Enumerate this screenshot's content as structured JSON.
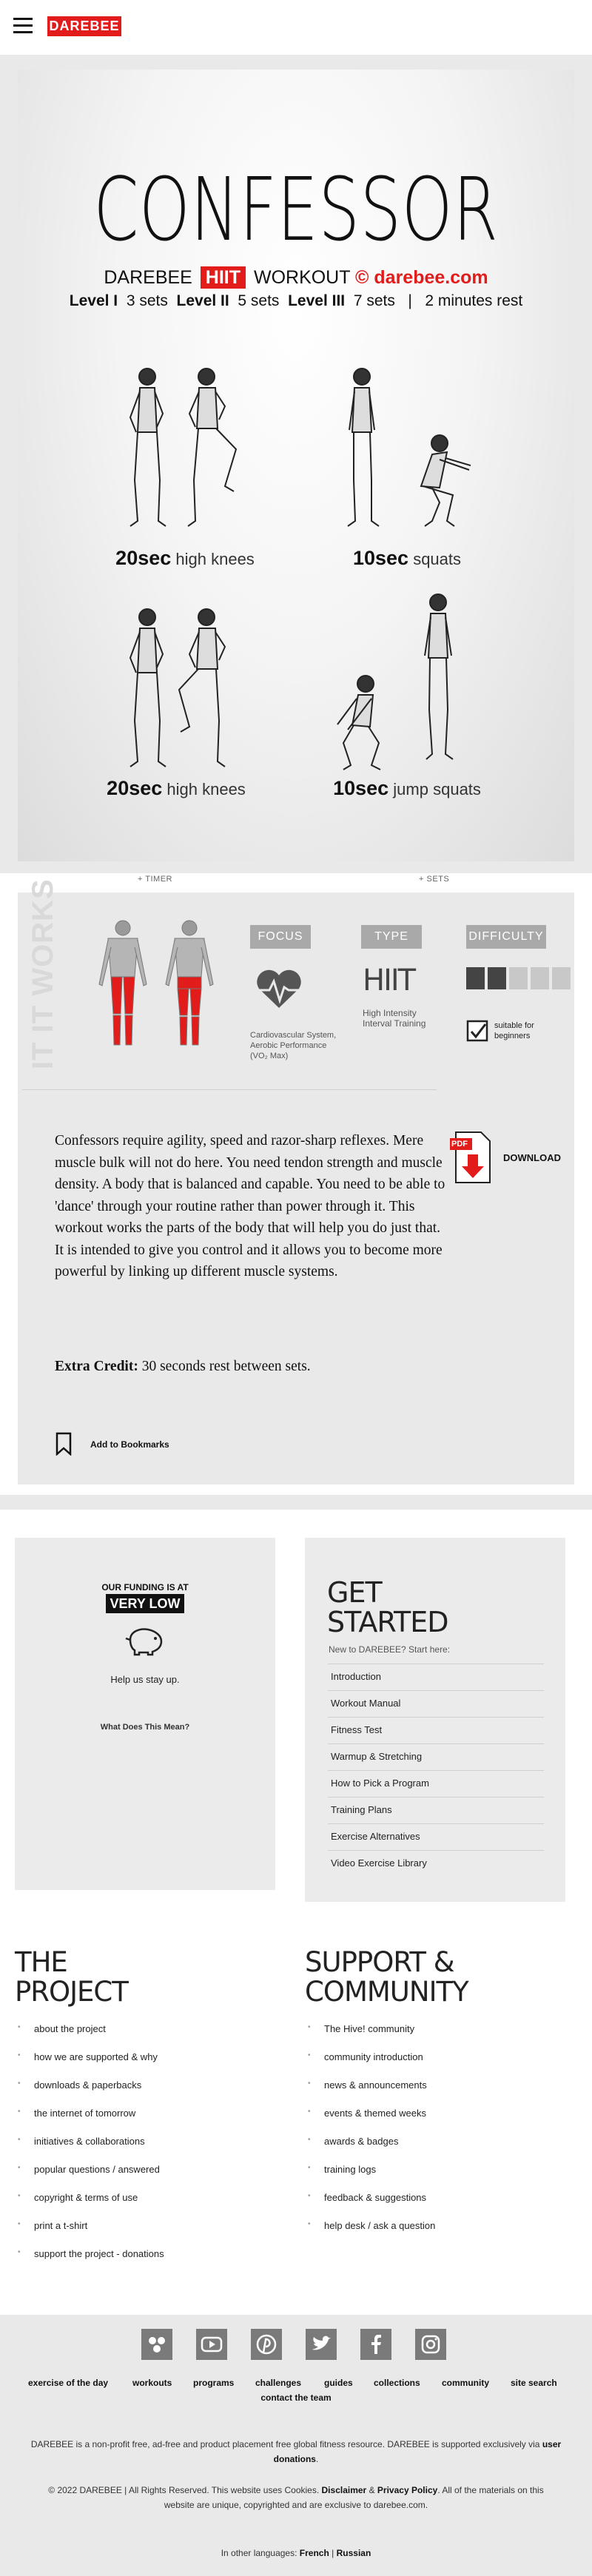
{
  "header": {
    "logo": "DAREBEE",
    "menu_icon": "hamburger-icon"
  },
  "poster": {
    "title": "CONFESSOR",
    "brand_prefix": "DAREBEE",
    "brand_badge": "HIIT",
    "brand_word": "WORKOUT",
    "brand_copyright": "©",
    "brand_site": "darebee.com",
    "levels": [
      {
        "label": "Level I",
        "value": "3 sets"
      },
      {
        "label": "Level II",
        "value": "5 sets"
      },
      {
        "label": "Level III",
        "value": "7 sets"
      }
    ],
    "separator": "|",
    "rest": "2 minutes rest",
    "exercises": [
      {
        "time": "20sec",
        "name": "high knees"
      },
      {
        "time": "10sec",
        "name": "squats"
      },
      {
        "time": "20sec",
        "name": "high knees"
      },
      {
        "time": "10sec",
        "name": "jump squats"
      }
    ]
  },
  "toggles": {
    "timer": "+ TIMER",
    "sets": "+ SETS"
  },
  "info": {
    "side_label": "IT IT WORKS",
    "focus": {
      "heading": "FOCUS",
      "text": "Cardiovascular System, Aerobic Performance (VO₂ Max)",
      "icon": "heart-rate-icon"
    },
    "type": {
      "heading": "TYPE",
      "value": "HIIT",
      "text": "High Intensity Interval Training"
    },
    "difficulty": {
      "heading": "DIFFICULTY",
      "level": 0.4,
      "check_text": "suitable for beginners"
    },
    "colors": {
      "accent": "#e21b1b",
      "badge": "#a9a9a9",
      "bar_on": "#444444",
      "bar_off": "#c8c8c8"
    },
    "description": "Confessors require agility, speed and razor-sharp reflexes. Mere muscle bulk will not do here. You need tendon strength and muscle density. A body that is balanced and capable. You need to be able to 'dance' through your routine rather than power through it. This workout works the parts of the body that will help you do just that. It is intended to give you control and it allows you to become more powerful by linking up different muscle systems.",
    "extra_credit_label": "Extra Credit:",
    "extra_credit_text": "30 seconds rest between sets.",
    "download_label": "DOWNLOAD",
    "pdf_badge": "PDF",
    "bookmark_label": "Add to Bookmarks"
  },
  "funding": {
    "line1": "OUR FUNDING IS AT",
    "line2": "VERY LOW",
    "help": "Help us stay up.",
    "link": "What Does This Mean?"
  },
  "get_started": {
    "title_line1": "GET",
    "title_line2": "STARTED",
    "subtitle": "New to DAREBEE? Start here:",
    "items": [
      "Introduction",
      "Workout Manual",
      "Fitness Test",
      "Warmup & Stretching",
      "How to Pick a Program",
      "Training Plans",
      "Exercise Alternatives",
      "Video Exercise Library"
    ]
  },
  "project": {
    "title_line1": "THE",
    "title_line2": "PROJECT",
    "items": [
      "about the project",
      "how we are supported & why",
      "downloads & paperbacks",
      "the internet of tomorrow",
      "initiatives & collaborations",
      "popular questions / answered",
      "copyright & terms of use",
      "print a t-shirt",
      "support the project - donations"
    ]
  },
  "support": {
    "title_line1": "SUPPORT &",
    "title_line2": "COMMUNITY",
    "items": [
      "The Hive! community",
      "community introduction",
      "news & announcements",
      "events & themed weeks",
      "awards & badges",
      "training logs",
      "feedback & suggestions",
      "help desk / ask a question"
    ]
  },
  "footer": {
    "social": [
      "hive-icon",
      "youtube-icon",
      "pinterest-icon",
      "twitter-icon",
      "facebook-icon",
      "instagram-icon"
    ],
    "links": [
      "exercise of the day",
      "workouts",
      "programs",
      "challenges",
      "guides",
      "collections",
      "community",
      "site search"
    ],
    "contact": "contact the team",
    "about": "DAREBEE is a non-profit free, ad-free and product placement free global fitness resource. DAREBEE is supported exclusively via",
    "about_link": "user donations",
    "about_end": ".",
    "copyright_a": "© 2022 DAREBEE | All Rights Reserved. This website uses Cookies.",
    "disclaimer": "Disclaimer",
    "amp": "&",
    "privacy": "Privacy Policy",
    "copyright_b": ". All of the materials on this website are unique, copyrighted and are exclusive to darebee.com.",
    "languages_label": "In other languages:",
    "lang_fr": "French",
    "lang_sep": "|",
    "lang_ru": "Russian"
  }
}
